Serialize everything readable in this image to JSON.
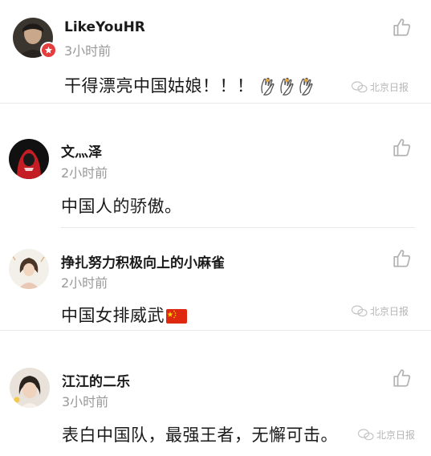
{
  "comments": [
    {
      "username": "LikeYouHR",
      "time": "3小时前",
      "text": "干得漂亮中国姑娘！！！",
      "trailing_emoji": [
        "clap-emoji",
        "clap-emoji",
        "clap-emoji"
      ],
      "verified_badge": true,
      "watermark": "北京日报"
    },
    {
      "username": "文灬泽",
      "time": "2小时前",
      "text": "中国人的骄傲。"
    },
    {
      "username": "挣扎努力积极向上的小麻雀",
      "time": "2小时前",
      "text": "中国女排威武",
      "trailing_emoji": [
        "china-flag-emoji"
      ],
      "watermark": "北京日报"
    },
    {
      "username": "江江的二乐",
      "time": "3小时前",
      "text": "表白中国队，最强王者，无懈可击。",
      "watermark": "北京日报"
    }
  ],
  "icons": {
    "like": "thumbs-up-outline-icon",
    "watermark": "wechat-bubble-icon"
  },
  "colors": {
    "text": "#1a1a1a",
    "meta": "#999999",
    "divider": "#e8e8e8",
    "badge": "#e63c3c",
    "like_icon": "#b3b3b3"
  }
}
